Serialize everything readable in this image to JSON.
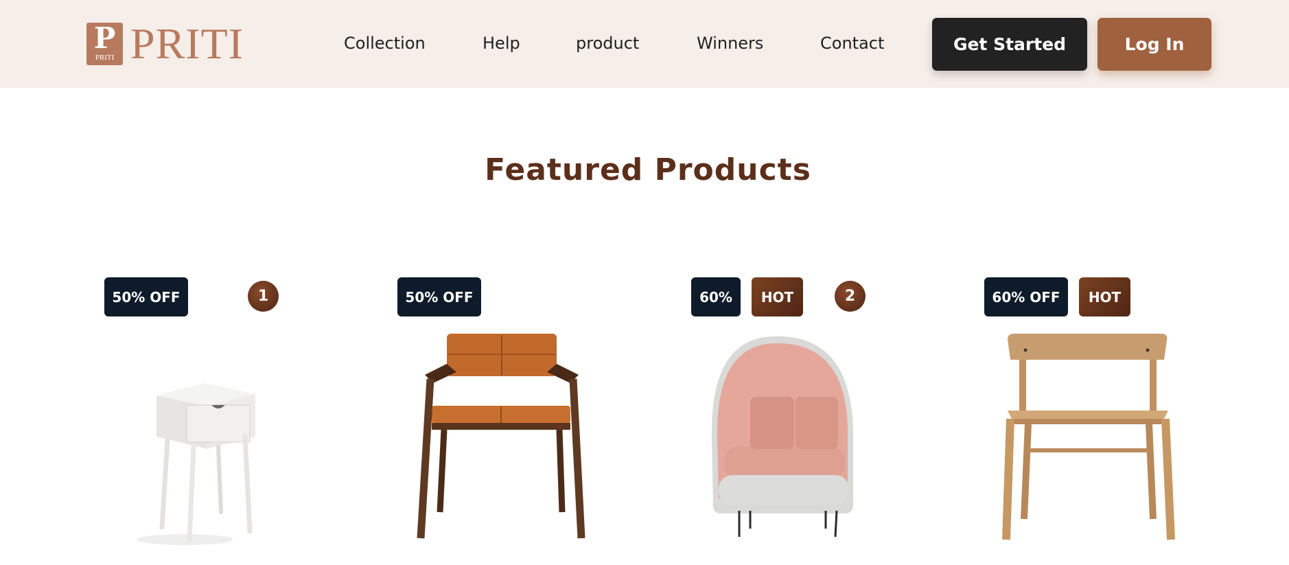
{
  "brand": {
    "monogram": "P",
    "monogram_sub": "PRITI",
    "wordmark": "PRITI"
  },
  "nav": [
    "Collection",
    "Help",
    "product",
    "Winners",
    "Contact"
  ],
  "buttons": {
    "get_started": "Get Started",
    "log_in": "Log In"
  },
  "section_title": "Featured Products",
  "products": [
    {
      "badges": [
        "50% OFF"
      ],
      "number": "1",
      "image": "white-nightstand"
    },
    {
      "badges": [
        "50% OFF"
      ],
      "number": "",
      "image": "leather-armchair"
    },
    {
      "badges": [
        "60%",
        "HOT"
      ],
      "number": "2",
      "image": "pink-lounge-chair"
    },
    {
      "badges": [
        "60% OFF",
        "HOT"
      ],
      "number": "",
      "image": "oak-chair"
    }
  ],
  "colors": {
    "header_bg": "#f5eee9",
    "accent": "#a0613f",
    "title": "#5c2f1b",
    "badge_dark": "#0e1b2a"
  }
}
